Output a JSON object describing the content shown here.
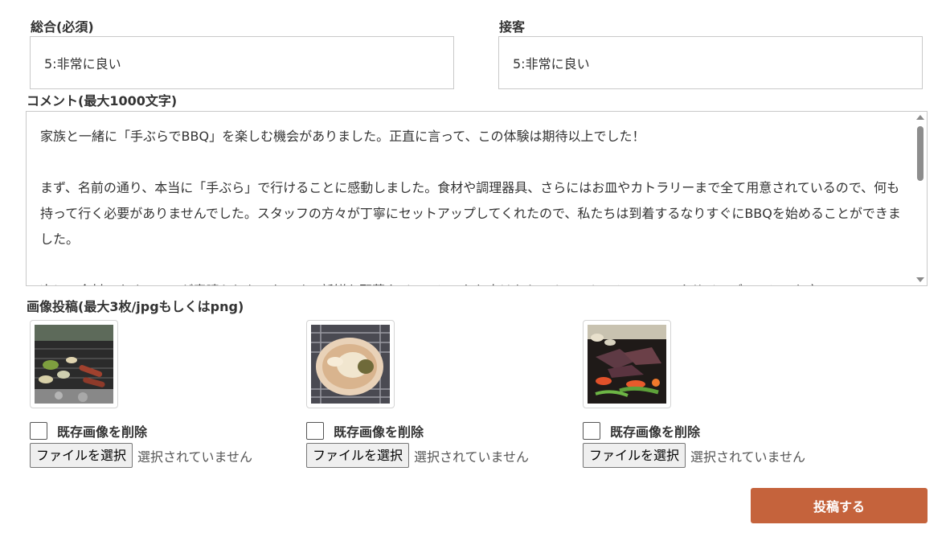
{
  "overall": {
    "label": "総合(必須)",
    "value": "5:非常に良い"
  },
  "service": {
    "label": "接客",
    "value": "5:非常に良い"
  },
  "comment": {
    "label": "コメント(最大1000文字)",
    "text": "家族と一緒に「手ぶらでBBQ」を楽しむ機会がありました。正直に言って、この体験は期待以上でした！\n\nまず、名前の通り、本当に「手ぶら」で行けることに感動しました。食材や調理器具、さらにはお皿やカトラリーまで全て用意されているので、何も持って行く必要がありませんでした。スタッフの方々が丁寧にセットアップしてくれたので、私たちは到着するなりすぐにBBQを始めることができました。\n\n次に、食材のクオリティが素晴らしかったです。新鮮な野菜やジューシーなお肉はもちろんのこと、シーフードやサイドディッシュも充"
  },
  "images": {
    "label": "画像投稿(最大3枚/jpgもしくはpng)",
    "slots": [
      {
        "delete_label": "既存画像を削除",
        "file_button": "ファイルを選択",
        "file_status": "選択されていません",
        "icon": "bbq-grill-photo"
      },
      {
        "delete_label": "既存画像を削除",
        "file_button": "ファイルを選択",
        "file_status": "選択されていません",
        "icon": "grilled-scallop-photo"
      },
      {
        "delete_label": "既存画像を削除",
        "file_button": "ファイルを選択",
        "file_status": "選択されていません",
        "icon": "grilled-meat-photo"
      }
    ]
  },
  "submit_label": "投稿する",
  "colors": {
    "accent": "#c5633c",
    "border": "#c9c9c9"
  }
}
